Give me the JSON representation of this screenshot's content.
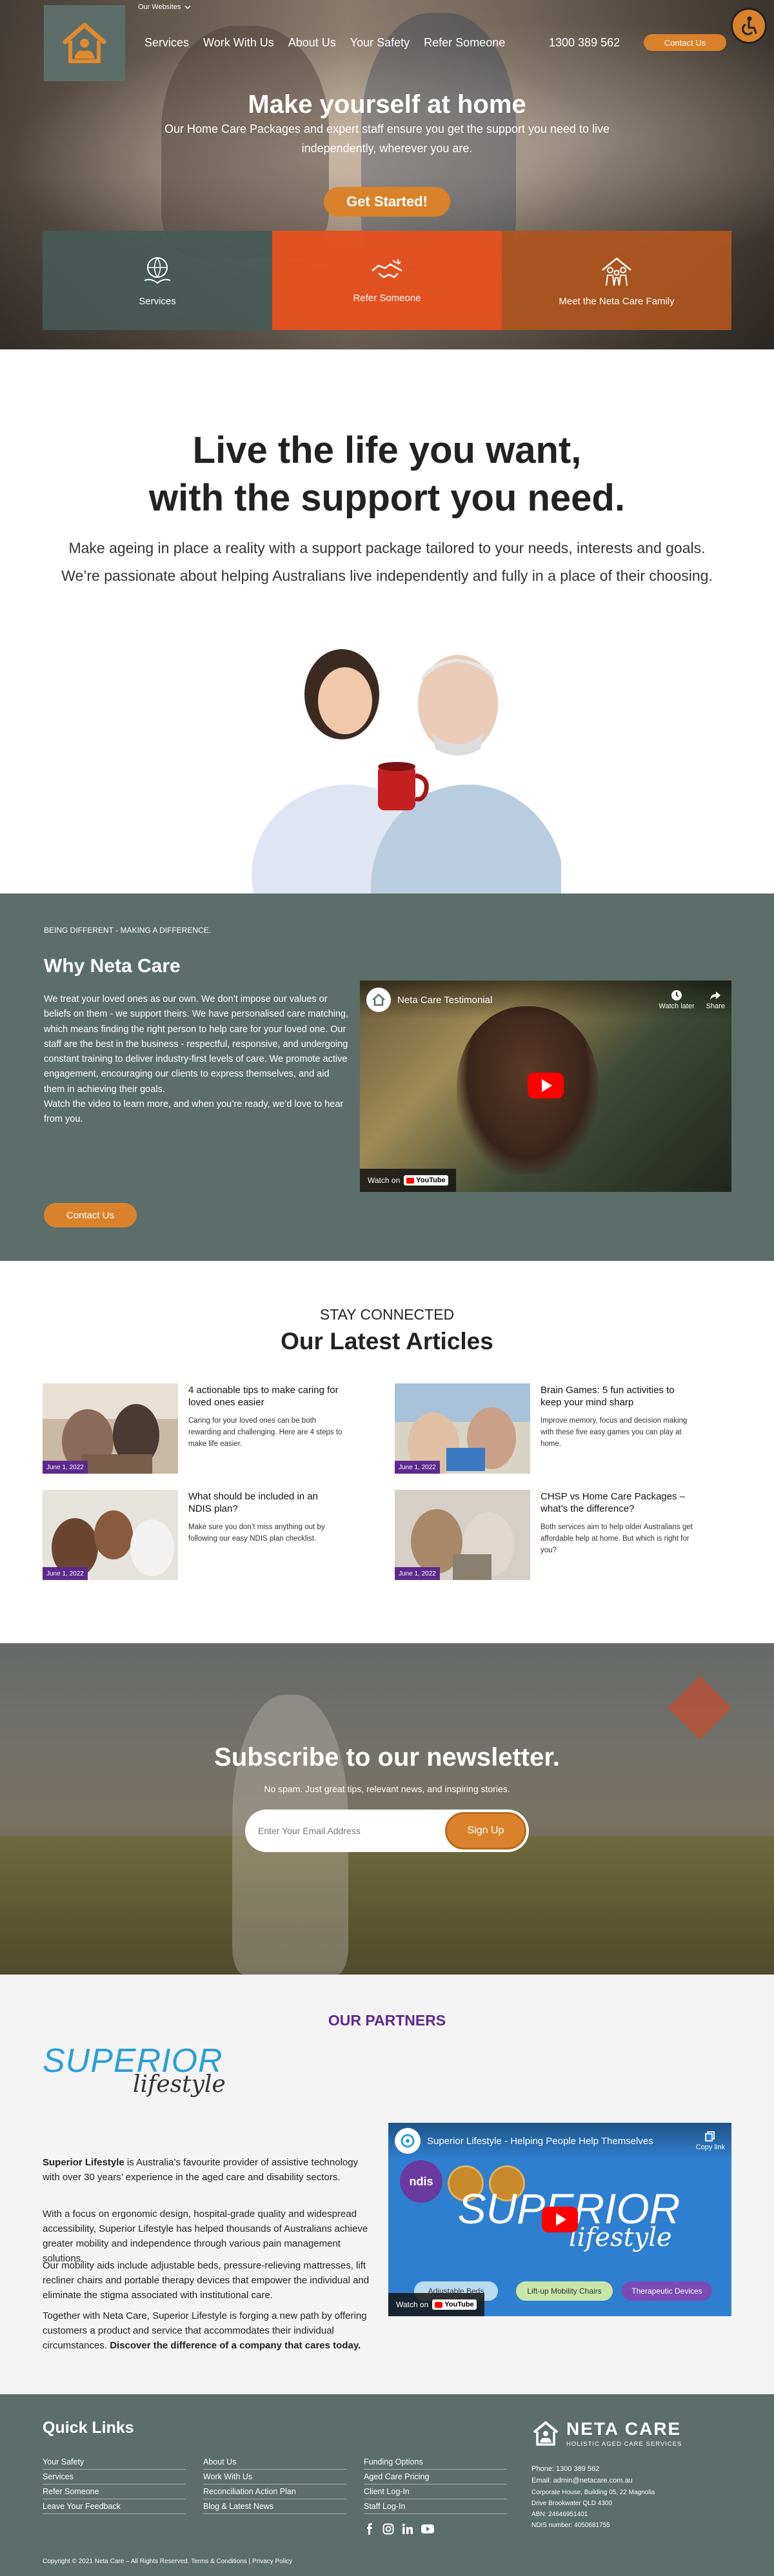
{
  "header": {
    "our_websites": "Our Websites",
    "nav": [
      "Services",
      "Work With Us",
      "About Us",
      "Your Safety",
      "Refer Someone"
    ],
    "phone": "1300 389 562",
    "contact_label": "Contact Us"
  },
  "hero": {
    "title": "Make yourself at home",
    "subtitle": "Our Home Care Packages and expert staff ensure you get the support you need to live independently, wherever you are.",
    "cta": "Get Started!",
    "tiles": [
      "Services",
      "Refer Someone",
      "Meet the Neta Care Family"
    ]
  },
  "intro": {
    "title_line1": "Live the life you want,",
    "title_line2": "with the support you need.",
    "text": "Make ageing in place a reality with a support package tailored to your needs, interests and goals. We’re passionate about helping Australians live independently and fully in a place of their choosing."
  },
  "why": {
    "eyebrow": "BEING DIFFERENT - MAKING A DIFFERENCE.",
    "title": "Why Neta Care",
    "text": "We treat your loved ones as our own. We don’t impose our values or beliefs on them - we support theirs. We have personalised care matching, which means finding the right person to help care for your loved one. Our staff are the best in the business - respectful, responsive, and undergoing constant training to deliver industry-first levels of care. We promote active engagement, encouraging our clients to express themselves, and aid them in achieving their goals.",
    "text2": "Watch the video to learn more, and when you’re ready, we’d love to hear from you.",
    "button": "Contact Us",
    "video": {
      "title": "Neta Care Testimonial",
      "watch_later": "Watch later",
      "share": "Share",
      "watch_on": "Watch on",
      "youtube": "YouTube"
    }
  },
  "articles": {
    "eyebrow": "STAY CONNECTED",
    "title": "Our Latest Articles",
    "items": [
      {
        "title": "4 actionable tips to make caring for loved ones easier",
        "excerpt": "Caring for your loved ones can be both rewarding and challenging. Here are 4 steps to make life easier.",
        "date": "June 1, 2022"
      },
      {
        "title": "Brain Games: 5 fun activities to keep your mind sharp",
        "excerpt": "Improve memory, focus and decision making with these five easy games you can play at home.",
        "date": "June 1, 2022"
      },
      {
        "title": "What should be included in an NDIS plan?",
        "excerpt": "Make sure you don’t miss anything out by following our easy NDIS plan checklist.",
        "date": "June 1, 2022"
      },
      {
        "title": "CHSP vs Home Care Packages – what’s the difference?",
        "excerpt": "Both services aim to help older Australians get affordable help at home. But which is right for you?",
        "date": "June 1, 2022"
      }
    ]
  },
  "newsletter": {
    "title": "Subscribe to our newsletter.",
    "subtitle": "No spam. Just great tips, relevant news, and inspiring stories.",
    "placeholder": "Enter Your Email Address",
    "button": "Sign Up"
  },
  "partners": {
    "title": "OUR PARTNERS",
    "logo_word1": "SUPERIOR",
    "logo_word2": "lifestyle",
    "p1_bold": "Superior Lifestyle",
    "p1_rest": " is Australia’s favourite provider of assistive technology with over 30 years’ experience in the aged care and disability sectors.",
    "p2": "With a focus on ergonomic design, hospital-grade quality and widespread accessibility, Superior Lifestyle has helped thousands of Australians achieve greater mobility and independence through various pain management solutions.",
    "p3": "Our mobility aids include adjustable beds, pressure-relieving mattresses, lift recliner chairs and portable therapy devices that empower the individual and eliminate the stigma associated with institutional care.",
    "p4": "Together with Neta Care, Superior Lifestyle is forging a new path by offering customers a product and service that accommodates their individual circumstances. ",
    "p4_bold": "Discover the difference of a company that cares today.",
    "video": {
      "title": "Superior Lifestyle - Helping People Help Themselves",
      "copy_link": "Copy link",
      "ndis": "ndis",
      "chips": [
        "Adjustable Beds",
        "Lift-up Mobility Chairs",
        "Therapeutic Devices"
      ],
      "watch_on": "Watch on",
      "youtube": "YouTube"
    }
  },
  "footer": {
    "quick_links": "Quick Links",
    "col1": [
      "Your Safety",
      "Services",
      "Refer Someone",
      "Leave Your Feedback"
    ],
    "col2": [
      "About Us",
      "Work With Us",
      "Reconciliation Action Plan",
      "Blog & Latest News"
    ],
    "col3": [
      "Funding Options",
      "Aged Care Pricing",
      "Client Log-In",
      "Staff Log-In"
    ],
    "brand": "NETA CARE",
    "tagline": "HOLISTIC AGED CARE SERVICES",
    "phone": "Phone: 1300 389 562",
    "email": "Email: admin@netacare.com.au",
    "address": "Corporate House, Building 05, 22 Magnolia Drive Brookwater QLD 4300",
    "abn": "ABN: 24646951401",
    "ndis": "NDIS number: 4050681755",
    "copyright": "Copyright © 2021 Neta Care – All Rights Reserved. Terms & Conditions | Privacy Policy"
  },
  "colors": {
    "teal": "#5c6e6a",
    "orange": "#d9822b",
    "red_orange": "#e8501e",
    "purple": "#5c2a8c",
    "sky_blue": "#2a9fd8"
  },
  "icons": [
    "house-hands-icon",
    "chevron-down-icon",
    "accessibility-icon",
    "globe-hands-icon",
    "handshake-icon",
    "family-icon",
    "facebook-icon",
    "instagram-icon",
    "linkedin-icon",
    "youtube-icon",
    "play-icon",
    "clock-icon",
    "share-icon"
  ]
}
